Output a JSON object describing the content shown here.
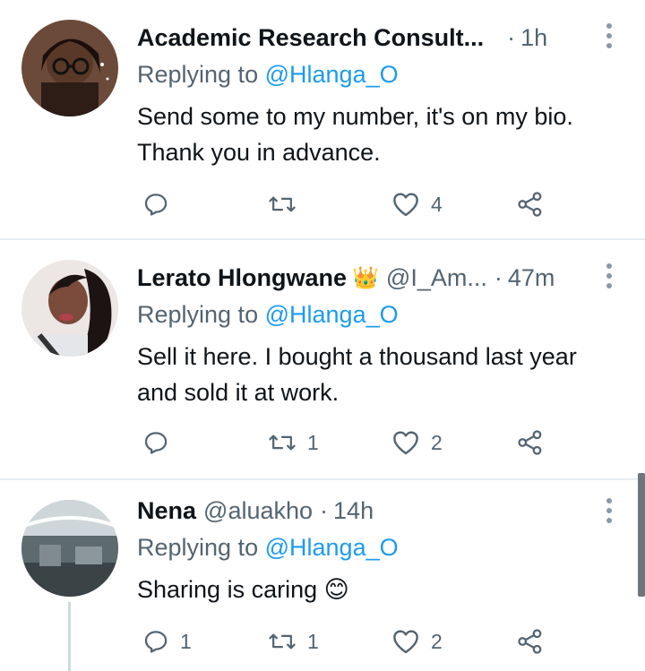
{
  "tweets": [
    {
      "name": "Academic Research Consult...",
      "handle": "",
      "separator": "·",
      "time": "1h",
      "replying_label": "Replying to",
      "replying_to": "@Hlanga_O",
      "text": "Send some to my number, it's on my bio. Thank you in advance.",
      "reply_count": "",
      "retweet_count": "",
      "like_count": "4"
    },
    {
      "name": "Lerato Hlongwane",
      "name_emoji": "👑",
      "handle": "@I_Am...",
      "separator": "·",
      "time": "47m",
      "replying_label": "Replying to",
      "replying_to": "@Hlanga_O",
      "text": "Sell it here. I bought a thousand last year and sold it at work.",
      "reply_count": "",
      "retweet_count": "1",
      "like_count": "2"
    },
    {
      "name": "Nena",
      "handle": "@aluakho",
      "separator": "·",
      "time": "14h",
      "replying_label": "Replying to",
      "replying_to": "@Hlanga_O",
      "text": "Sharing is caring",
      "text_emoji": "😊",
      "reply_count": "1",
      "retweet_count": "1",
      "like_count": "2"
    }
  ],
  "icons": {
    "reply": "reply-icon",
    "retweet": "retweet-icon",
    "like": "heart-icon",
    "share": "share-icon",
    "more": "more-vertical-icon"
  },
  "colors": {
    "accent": "#1d9bf0",
    "secondary_text": "#536471",
    "divider": "#e6ecf0"
  }
}
